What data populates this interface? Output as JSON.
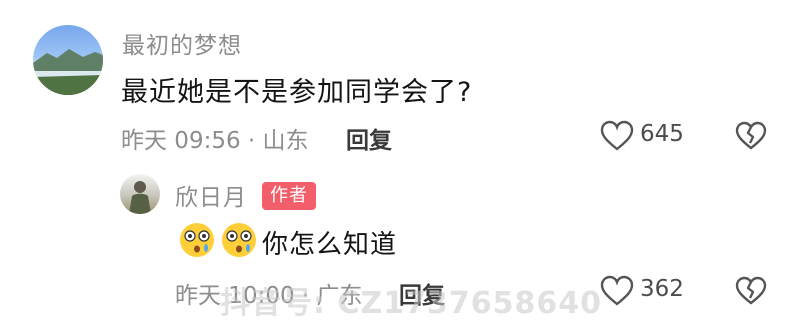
{
  "comment": {
    "username": "最初的梦想",
    "text": "最近她是不是参加同学会了?",
    "meta": "昨天 09:56 · 山东",
    "reply_label": "回复",
    "like_count": "645"
  },
  "reply": {
    "username": "欣日月",
    "badge": "作者",
    "text": "你怎么知道",
    "meta": "昨天 10:00 · 广东",
    "reply_label": "回复",
    "like_count": "362"
  },
  "watermark": "抖音号: CZ1737658640",
  "colors": {
    "badge": "#f25e6a",
    "muted_text": "#8d8d8d",
    "body_text": "#141414"
  }
}
